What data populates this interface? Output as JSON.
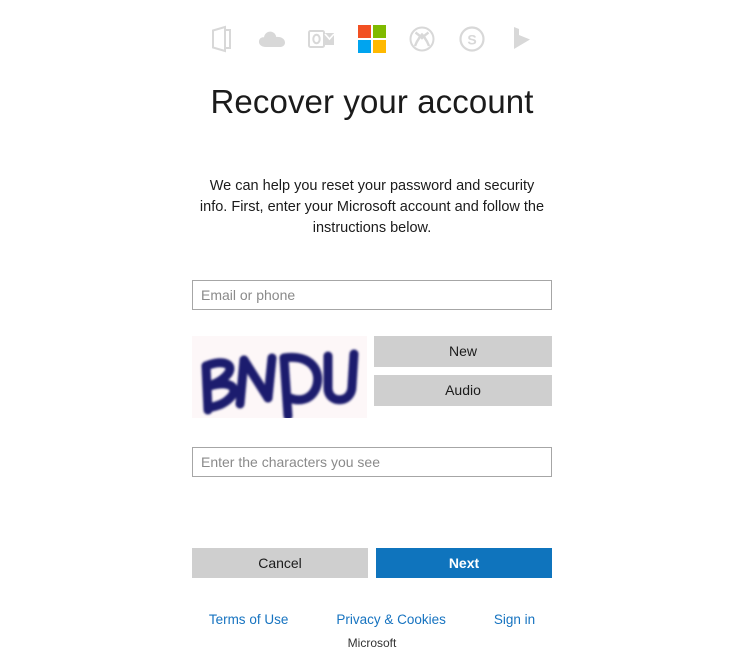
{
  "brand": {
    "logo_colors": {
      "red": "#f25022",
      "green": "#7fba00",
      "blue": "#00a4ef",
      "yellow": "#ffb900"
    },
    "icon_grey": "#d8d8d8",
    "accent_blue": "#0f74bd",
    "link_blue": "#1673c0",
    "button_grey": "#cfcfcf"
  },
  "icon_strip": [
    {
      "name": "office-icon",
      "label": "Office"
    },
    {
      "name": "onedrive-icon",
      "label": "OneDrive"
    },
    {
      "name": "outlook-icon",
      "label": "Outlook"
    },
    {
      "name": "microsoft-logo-icon",
      "label": "Microsoft"
    },
    {
      "name": "xbox-icon",
      "label": "Xbox"
    },
    {
      "name": "skype-icon",
      "label": "Skype"
    },
    {
      "name": "bing-icon",
      "label": "Bing"
    }
  ],
  "heading": "Recover your account",
  "description": "We can help you reset your password and security info. First, enter your Microsoft account and follow the instructions below.",
  "account_field": {
    "placeholder": "Email or phone",
    "value": ""
  },
  "captcha": {
    "challenge_text": "BNDU",
    "new_label": "New",
    "audio_label": "Audio",
    "answer_field": {
      "placeholder": "Enter the characters you see",
      "value": ""
    }
  },
  "actions": {
    "cancel_label": "Cancel",
    "next_label": "Next"
  },
  "footer": {
    "links": [
      "Terms of Use",
      "Privacy & Cookies",
      "Sign in"
    ],
    "brand": "Microsoft"
  }
}
